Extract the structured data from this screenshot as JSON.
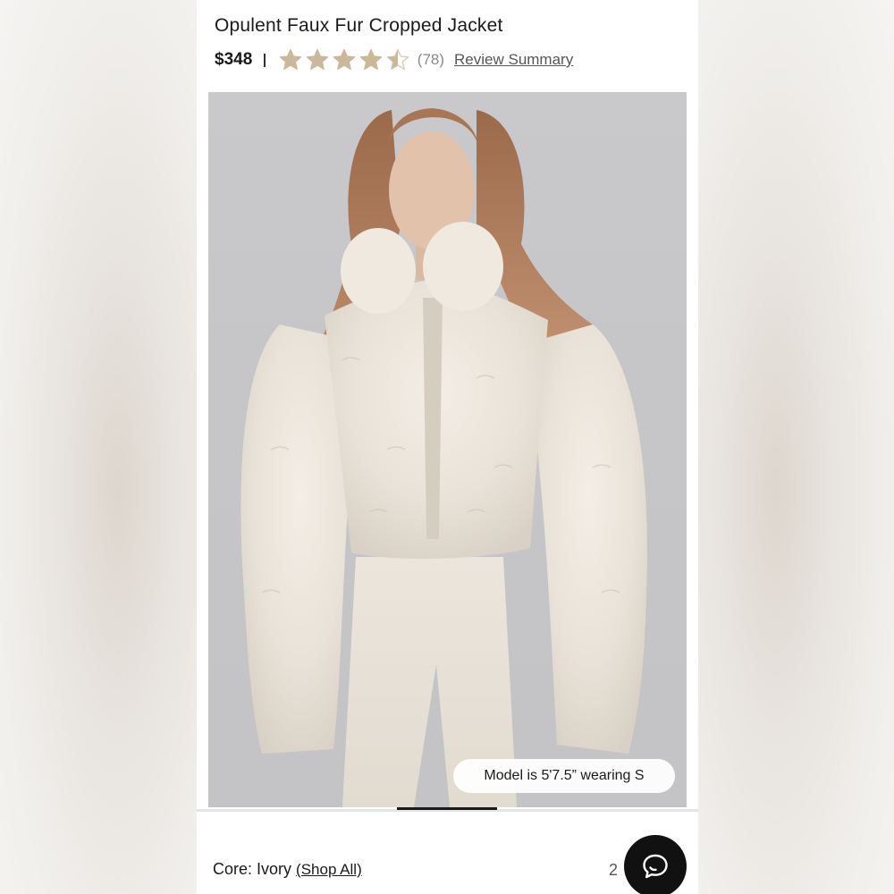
{
  "product": {
    "title": "Opulent Faux Fur Cropped Jacket",
    "price": "$348",
    "rating": 4.5,
    "rating_max": 5,
    "review_count": "(78)",
    "review_summary_label": "Review Summary"
  },
  "gallery": {
    "model_note": "Model is 5'7.5” wearing S",
    "current_slide_fraction": 0.2
  },
  "color": {
    "label": "Core: Ivory",
    "shop_all_label": "(Shop All)",
    "swatch_count": "2"
  },
  "colors": {
    "star": "#cbb89a",
    "star_empty": "#d9cbb5",
    "text": "#1a1a1a",
    "chat_button": "#111111"
  },
  "icons": {
    "rating": "star-icon",
    "chat": "chat-bubble-icon"
  }
}
